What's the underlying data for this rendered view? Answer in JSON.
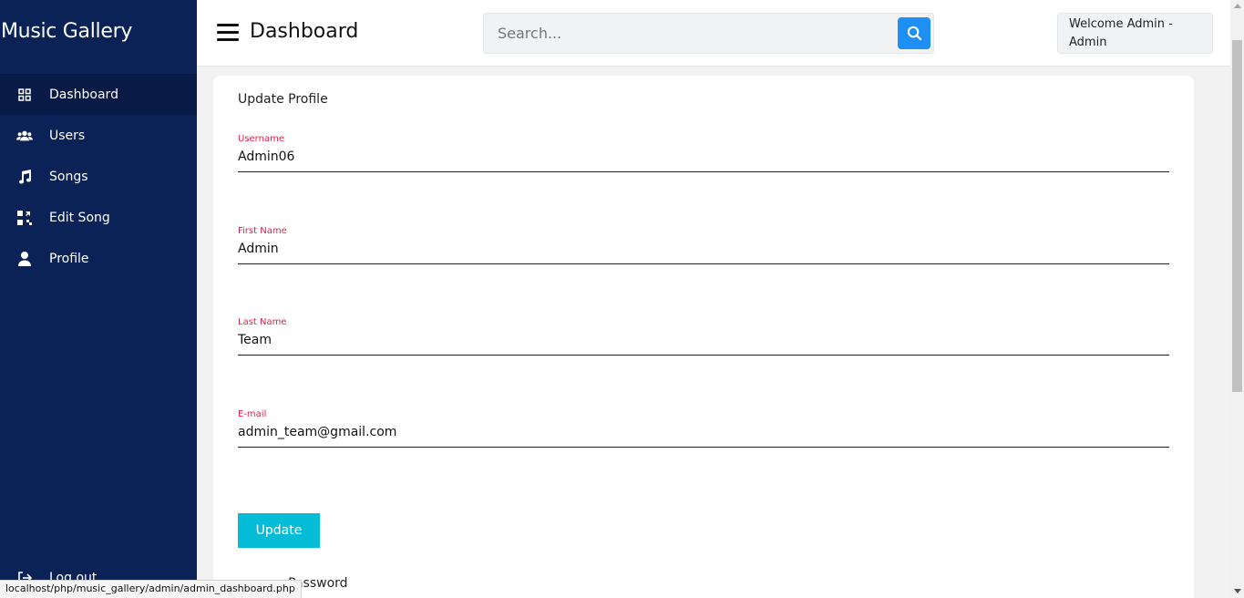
{
  "sidebar": {
    "brand": "Music Gallery",
    "items": [
      {
        "label": "Dashboard",
        "icon": "grid-icon",
        "active": true
      },
      {
        "label": "Users",
        "icon": "users-icon",
        "active": false
      },
      {
        "label": "Songs",
        "icon": "music-note-icon",
        "active": false
      },
      {
        "label": "Edit Song",
        "icon": "edit-grid-icon",
        "active": false
      },
      {
        "label": "Profile",
        "icon": "user-icon",
        "active": false
      }
    ],
    "logout_label": "Log out"
  },
  "header": {
    "title": "Dashboard",
    "search_placeholder": "Search...",
    "welcome": "Welcome Admin - Admin"
  },
  "profile_form": {
    "title": "Update Profile",
    "fields": [
      {
        "label": "Username",
        "value": "Admin06"
      },
      {
        "label": "First Name",
        "value": "Admin"
      },
      {
        "label": "Last Name",
        "value": "Team"
      },
      {
        "label": "E-mail",
        "value": "admin_team@gmail.com"
      }
    ],
    "submit_label": "Update"
  },
  "password_section": {
    "title": "Password"
  },
  "statusbar": {
    "url": "localhost/php/music_gallery/admin/admin_dashboard.php"
  },
  "colors": {
    "sidebar_bg": "#0b2256",
    "accent_search": "#1e90f5",
    "update_button": "#05bcd6",
    "field_label": "#dc1f4a"
  }
}
